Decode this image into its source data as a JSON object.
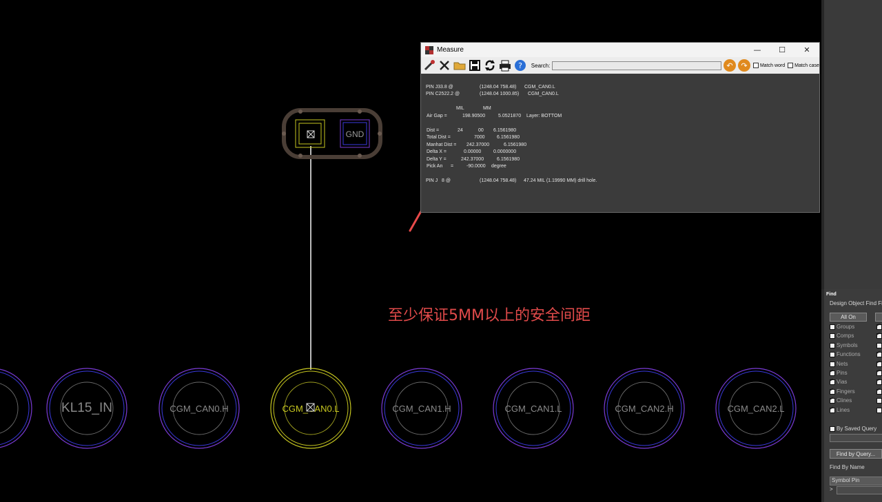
{
  "canvas": {
    "gnd_label": "GND",
    "pads": [
      {
        "label": ""
      },
      {
        "label": "KL15_IN"
      },
      {
        "label": "CGM_CAN0.H"
      },
      {
        "label": "CGM_CAN0.L"
      },
      {
        "label": "CGM_CAN1.H"
      },
      {
        "label": "CGM_CAN1.L"
      },
      {
        "label": "CGM_CAN2.H"
      },
      {
        "label": "CGM_CAN2.L"
      }
    ],
    "annotation_text": "至少保证5MM以上的安全间距",
    "colors": {
      "highlight": "#c8c820",
      "pad_ring": "#7a3bd6",
      "annotation": "#e04a4a",
      "arrow": "#e84a4a"
    }
  },
  "measure_window": {
    "title": "Measure",
    "search_label": "Search:",
    "search_value": "",
    "match_word_label": "Match word",
    "match_case_label": "Match case",
    "report": {
      "pin1": {
        "name": "PIN J33.8 @",
        "coord": "(1248.04 758.48)",
        "net": "CGM_CAN0.L"
      },
      "pin2": {
        "name": "PIN C2522.2 @",
        "coord": "(1248.04 1000.85)",
        "net": "CGM_CAN0.L"
      },
      "unit_mil": "MIL",
      "unit_mm": "MM",
      "air_gap": {
        "label": "Air Gap =",
        "mil": "198.90500",
        "mm": "5.0521870",
        "extra": "Layer: BOTTOM"
      },
      "dist": {
        "label": "Dist =",
        "mil": "24",
        "mil_tail": "00",
        "mm": "6.1561980"
      },
      "total_dist": {
        "label": "Total Dist =",
        "mil_tail": "7000",
        "mm": "6.1561980"
      },
      "manhat_dist": {
        "label": "Manhat Dist =",
        "mil": "242.37000",
        "mm": "6.1561980"
      },
      "delta_x": {
        "label": "Delta X =",
        "mil": "0.00000",
        "mm": "0.0000000"
      },
      "delta_y": {
        "label": "Delta Y =",
        "mil": "242.37000",
        "mm": "6.1561980"
      },
      "pick_angle": {
        "label": "Pick An",
        "label_tail": "=",
        "value": "-90.0000",
        "unit": "degree"
      },
      "pin3": {
        "name": "PIN J",
        "name_tail": "8 @",
        "coord": "(1248.04 758.48)",
        "desc": "47.24 MIL (1.19990 MM) drill hole."
      }
    }
  },
  "find_panel": {
    "title": "Find",
    "subtitle": "Design Object Find Fil",
    "all_on_label": "All On",
    "filters": [
      {
        "label": "Groups",
        "checked": false,
        "right_checked": true
      },
      {
        "label": "Comps",
        "checked": false,
        "right_checked": true
      },
      {
        "label": "Symbols",
        "checked": false,
        "right_checked": false
      },
      {
        "label": "Functions",
        "checked": false,
        "right_checked": true
      },
      {
        "label": "Nets",
        "checked": false,
        "right_checked": true
      },
      {
        "label": "Pins",
        "checked": true,
        "right_checked": true
      },
      {
        "label": "Vias",
        "checked": true,
        "right_checked": true
      },
      {
        "label": "Fingers",
        "checked": true,
        "right_checked": true
      },
      {
        "label": "Clines",
        "checked": true,
        "right_checked": false
      },
      {
        "label": "Lines",
        "checked": true,
        "right_checked": false
      }
    ],
    "by_saved_query_label": "By Saved Query",
    "find_by_query_label": "Find by Query...",
    "find_by_name_label": "Find By Name",
    "find_by_name_type": "Symbol Pin",
    "find_by_name_prompt": ">"
  }
}
